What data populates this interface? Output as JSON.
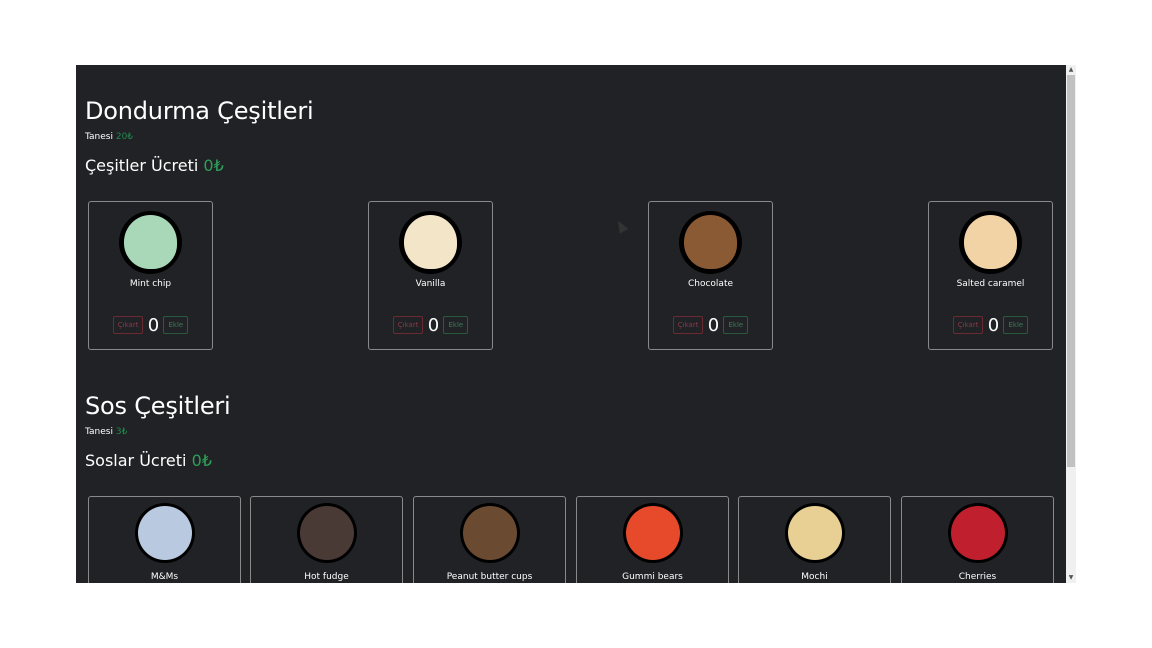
{
  "scoops": {
    "title": "Dondurma Çeşitleri",
    "unit_label": "Tanesi",
    "unit_price": "20₺",
    "total_label": "Çeşitler Ücreti",
    "total_value": "0₺",
    "items": [
      {
        "name": "Mint chip",
        "count": "0",
        "remove_label": "Çıkart",
        "add_label": "Ekle",
        "color": "#a8d8b8"
      },
      {
        "name": "Vanilla",
        "count": "0",
        "remove_label": "Çıkart",
        "add_label": "Ekle",
        "color": "#f3e6c8"
      },
      {
        "name": "Chocolate",
        "count": "0",
        "remove_label": "Çıkart",
        "add_label": "Ekle",
        "color": "#8a5a34"
      },
      {
        "name": "Salted caramel",
        "count": "0",
        "remove_label": "Çıkart",
        "add_label": "Ekle",
        "color": "#f2d3a5"
      }
    ]
  },
  "toppings": {
    "title": "Sos Çeşitleri",
    "unit_label": "Tanesi",
    "unit_price": "3₺",
    "total_label": "Soslar Ücreti",
    "total_value": "0₺",
    "items": [
      {
        "name": "M&Ms",
        "color": "#b9c9e0"
      },
      {
        "name": "Hot fudge",
        "color": "#4a3a36"
      },
      {
        "name": "Peanut butter cups",
        "color": "#6b4a32"
      },
      {
        "name": "Gummi bears",
        "color": "#e64a2a"
      },
      {
        "name": "Mochi",
        "color": "#e8cf93"
      },
      {
        "name": "Cherries",
        "color": "#c0202e"
      }
    ]
  },
  "colors": {
    "background": "#212226",
    "accent_green": "#2e9e58",
    "remove_red": "#8a3a44"
  }
}
